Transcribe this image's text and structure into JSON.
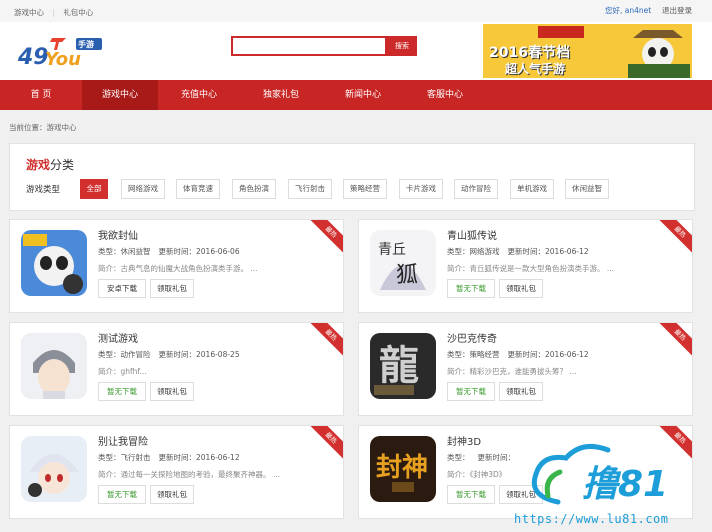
{
  "topbar": {
    "links": [
      "游戏中心",
      "礼包中心"
    ],
    "greeting": "您好,",
    "username": "an4net",
    "logout": "退出登录"
  },
  "header": {
    "logo_text": "49You",
    "logo_sub": "手游",
    "search_placeholder": "",
    "search_button": "搜索",
    "banner": {
      "year": "2016春节档",
      "tagline": "超人气手游"
    }
  },
  "nav": {
    "items": [
      "首 页",
      "游戏中心",
      "充值中心",
      "独家礼包",
      "新闻中心",
      "客服中心"
    ],
    "active_index": 1
  },
  "breadcrumb": "当前位置：游戏中心",
  "category": {
    "title_highlight": "游戏",
    "title_rest": "分类",
    "type_label": "游戏类型",
    "tags": [
      "全部",
      "网络游戏",
      "体育竞速",
      "角色扮演",
      "飞行射击",
      "策略经营",
      "卡片游戏",
      "动作冒险",
      "单机游戏",
      "休闲益智"
    ],
    "active_tag": 0
  },
  "labels": {
    "type_prefix": "类型：",
    "update_prefix": "更新时间：",
    "intro_prefix": "简介：",
    "gift_button": "领取礼包",
    "ribbon": "最热"
  },
  "games": [
    {
      "name": "我欲封仙",
      "type": "休闲益智",
      "updated": "2016-06-06",
      "intro": "古典气息的仙魔大战角色扮演类手游。 ...",
      "download": "安卓下载"
    },
    {
      "name": "青山狐传说",
      "type": "网络游戏",
      "updated": "2016-06-12",
      "intro": "青丘狐传说是一款大型角色扮演类手游。 ...",
      "download": "暂无下载"
    },
    {
      "name": "测试游戏",
      "type": "动作冒险",
      "updated": "2016-08-25",
      "intro": "ghfhf...",
      "download": "暂无下载"
    },
    {
      "name": "沙巴克传奇",
      "type": "策略经营",
      "updated": "2016-06-12",
      "intro": "精彩沙巴克，谁能勇拔头筹？ ...",
      "download": "暂无下载"
    },
    {
      "name": "别让我冒险",
      "type": "飞行射击",
      "updated": "2016-06-12",
      "intro": "通过每一关探险地图的考验，最终聚齐神器。 ...",
      "download": "暂无下载"
    },
    {
      "name": "封神3D",
      "type": "",
      "updated": "",
      "intro": "《封神3D》",
      "download": "暂无下载"
    }
  ],
  "watermark": {
    "brand": "撸81",
    "url": "https://www.lu81.com"
  }
}
